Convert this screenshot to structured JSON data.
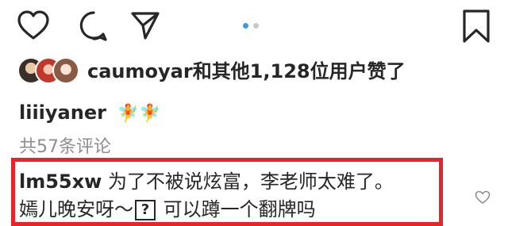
{
  "actions": {
    "like_icon": "heart-outline-icon",
    "comment_icon": "comment-bubble-icon",
    "share_icon": "paper-plane-icon",
    "save_icon": "bookmark-icon"
  },
  "carousel": {
    "active_color": "#3897f0",
    "inactive_color": "#c7c7c7",
    "count": 2,
    "active_index": 0
  },
  "likes": {
    "username": "caumoyar",
    "text": "和其他1,128位用户赞了"
  },
  "caption": {
    "username": "liiiyaner",
    "emoji": "🧚🧚"
  },
  "comments_count_text": "共57条评论",
  "comment": {
    "username": "lm55xw",
    "text_line1": "为了不被说炫富，李老师太难了。",
    "text_line2_a": "嫣儿晚安呀～",
    "placeholder_glyph": "?",
    "text_line2_b": " 可以蹲一个翻牌吗",
    "like_icon": "heart-outline-icon-small"
  },
  "highlight_color": "#e7242b"
}
